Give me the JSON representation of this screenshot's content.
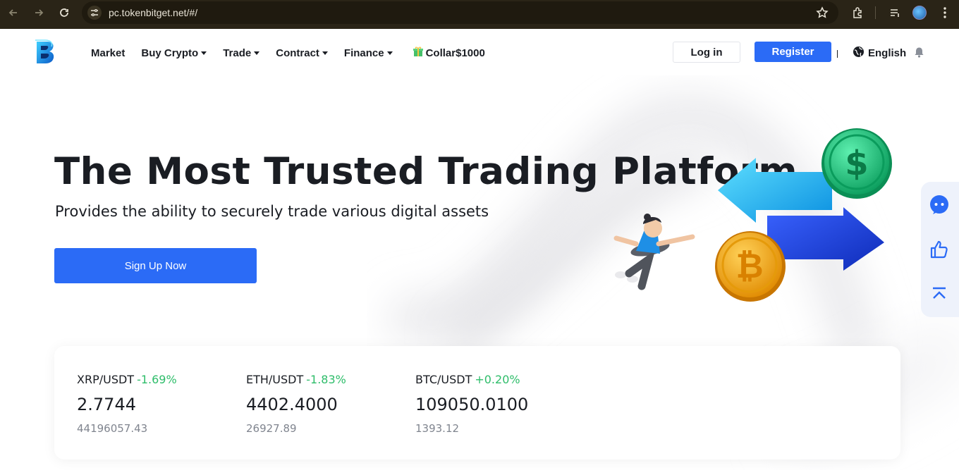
{
  "browser": {
    "url": "pc.tokenbitget.net/#/"
  },
  "header": {
    "nav": [
      {
        "label": "Market",
        "dropdown": false
      },
      {
        "label": "Buy Crypto",
        "dropdown": true
      },
      {
        "label": "Trade",
        "dropdown": true
      },
      {
        "label": "Contract",
        "dropdown": true
      },
      {
        "label": "Finance",
        "dropdown": true
      }
    ],
    "promo_label": "Collar$1000",
    "login_label": "Log in",
    "register_label": "Register",
    "language_label": "English"
  },
  "hero": {
    "title": "The Most Trusted Trading Platform",
    "subtitle": "Provides the ability to securely trade various digital assets",
    "cta_label": "Sign Up Now"
  },
  "tickers": [
    {
      "pair": "XRP/USDT",
      "change": "-1.69%",
      "price": "2.7744",
      "volume": "44196057.43"
    },
    {
      "pair": "ETH/USDT",
      "change": "-1.83%",
      "price": "4402.4000",
      "volume": "26927.89"
    },
    {
      "pair": "BTC/USDT",
      "change": "+0.20%",
      "price": "109050.0100",
      "volume": "1393.12"
    }
  ],
  "colors": {
    "accent": "#2b6bf6",
    "change": "#2ebd6a",
    "text": "#1a1d23",
    "muted": "#80858f"
  },
  "icons": {
    "side_panel": [
      "chat-icon",
      "thumbs-up-icon",
      "back-to-top-icon"
    ]
  }
}
